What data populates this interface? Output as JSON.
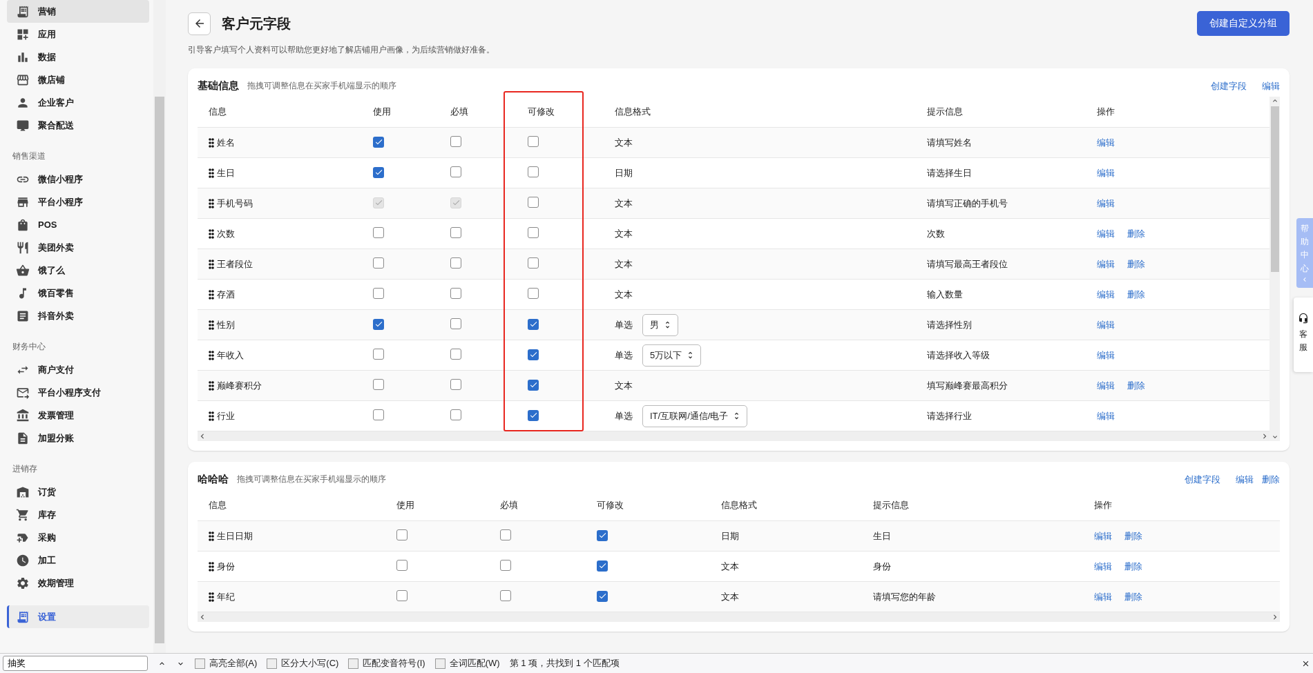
{
  "sidebar": {
    "groups": [
      {
        "items": [
          {
            "label": "营销",
            "selected": false,
            "hovered": true
          },
          {
            "label": "应用",
            "selected": false,
            "hovered": false
          },
          {
            "label": "数据",
            "selected": false,
            "hovered": false
          },
          {
            "label": "微店铺",
            "selected": false,
            "hovered": false
          },
          {
            "label": "企业客户",
            "selected": false,
            "hovered": false
          },
          {
            "label": "聚合配送",
            "selected": false,
            "hovered": false
          }
        ]
      },
      {
        "title": "销售渠道",
        "items": [
          {
            "label": "微信小程序",
            "selected": false,
            "hovered": false
          },
          {
            "label": "平台小程序",
            "selected": false,
            "hovered": false
          },
          {
            "label": "POS",
            "selected": false,
            "hovered": false
          },
          {
            "label": "美团外卖",
            "selected": false,
            "hovered": false
          },
          {
            "label": "饿了么",
            "selected": false,
            "hovered": false
          },
          {
            "label": "饿百零售",
            "selected": false,
            "hovered": false
          },
          {
            "label": "抖音外卖",
            "selected": false,
            "hovered": false
          }
        ]
      },
      {
        "title": "财务中心",
        "items": [
          {
            "label": "商户支付",
            "selected": false,
            "hovered": false
          },
          {
            "label": "平台小程序支付",
            "selected": false,
            "hovered": false
          },
          {
            "label": "发票管理",
            "selected": false,
            "hovered": false
          },
          {
            "label": "加盟分账",
            "selected": false,
            "hovered": false
          }
        ]
      },
      {
        "title": "进销存",
        "items": [
          {
            "label": "订货",
            "selected": false,
            "hovered": false
          },
          {
            "label": "库存",
            "selected": false,
            "hovered": false
          },
          {
            "label": "采购",
            "selected": false,
            "hovered": false
          },
          {
            "label": "加工",
            "selected": false,
            "hovered": false
          },
          {
            "label": "效期管理",
            "selected": false,
            "hovered": false
          }
        ]
      },
      {
        "items": [
          {
            "label": "设置",
            "selected": true,
            "hovered": false
          }
        ]
      }
    ]
  },
  "page": {
    "title": "客户元字段",
    "subtitle": "引导客户填写个人资料可以帮助您更好地了解店铺用户画像，为后续营销做好准备。",
    "primary_button": "创建自定义分组"
  },
  "sections": [
    {
      "title": "基础信息",
      "hint": "拖拽可调整信息在买家手机端显示的顺序",
      "actions": [
        "创建字段",
        "编辑"
      ],
      "columns": [
        {
          "label": "信息",
          "highlighted": false
        },
        {
          "label": "使用",
          "highlighted": false
        },
        {
          "label": "必填",
          "highlighted": false
        },
        {
          "label": "可修改",
          "highlighted": true
        },
        {
          "label": "信息格式",
          "highlighted": false
        },
        {
          "label": "提示信息",
          "highlighted": false
        },
        {
          "label": "操作",
          "highlighted": false
        }
      ],
      "rows": [
        {
          "name": "姓名",
          "use": {
            "checked": true,
            "disabled": false
          },
          "required": {
            "checked": false,
            "disabled": false
          },
          "editable": {
            "checked": false,
            "disabled": false
          },
          "format": "文本",
          "hint": "请填写姓名",
          "actions": [
            "编辑"
          ]
        },
        {
          "name": "生日",
          "use": {
            "checked": true,
            "disabled": false
          },
          "required": {
            "checked": false,
            "disabled": false
          },
          "editable": {
            "checked": false,
            "disabled": false
          },
          "format": "日期",
          "hint": "请选择生日",
          "actions": [
            "编辑"
          ]
        },
        {
          "name": "手机号码",
          "use": {
            "checked": true,
            "disabled": true
          },
          "required": {
            "checked": true,
            "disabled": true
          },
          "editable": {
            "checked": false,
            "disabled": false
          },
          "format": "文本",
          "hint": "请填写正确的手机号",
          "actions": [
            "编辑"
          ]
        },
        {
          "name": "次数",
          "use": {
            "checked": false,
            "disabled": false
          },
          "required": {
            "checked": false,
            "disabled": false
          },
          "editable": {
            "checked": false,
            "disabled": false
          },
          "format": "文本",
          "hint": "次数",
          "actions": [
            "编辑",
            "删除"
          ]
        },
        {
          "name": "王者段位",
          "use": {
            "checked": false,
            "disabled": false
          },
          "required": {
            "checked": false,
            "disabled": false
          },
          "editable": {
            "checked": false,
            "disabled": false
          },
          "format": "文本",
          "hint": "请填写最高王者段位",
          "actions": [
            "编辑",
            "删除"
          ]
        },
        {
          "name": "存酒",
          "use": {
            "checked": false,
            "disabled": false
          },
          "required": {
            "checked": false,
            "disabled": false
          },
          "editable": {
            "checked": false,
            "disabled": false
          },
          "format": "文本",
          "hint": "输入数量",
          "actions": [
            "编辑",
            "删除"
          ]
        },
        {
          "name": "性别",
          "use": {
            "checked": true,
            "disabled": false
          },
          "required": {
            "checked": false,
            "disabled": false
          },
          "editable": {
            "checked": true,
            "disabled": false
          },
          "format": "单选",
          "select": "男",
          "hint": "请选择性别",
          "actions": [
            "编辑"
          ]
        },
        {
          "name": "年收入",
          "use": {
            "checked": false,
            "disabled": false
          },
          "required": {
            "checked": false,
            "disabled": false
          },
          "editable": {
            "checked": true,
            "disabled": false
          },
          "format": "单选",
          "select": "5万以下",
          "hint": "请选择收入等级",
          "actions": [
            "编辑"
          ]
        },
        {
          "name": "巅峰赛积分",
          "use": {
            "checked": false,
            "disabled": false
          },
          "required": {
            "checked": false,
            "disabled": false
          },
          "editable": {
            "checked": true,
            "disabled": false
          },
          "format": "文本",
          "hint": "填写巅峰赛最高积分",
          "actions": [
            "编辑",
            "删除"
          ]
        },
        {
          "name": "行业",
          "use": {
            "checked": false,
            "disabled": false
          },
          "required": {
            "checked": false,
            "disabled": false
          },
          "editable": {
            "checked": true,
            "disabled": false
          },
          "format": "单选",
          "select": "IT/互联网/通信/电子",
          "hint": "请选择行业",
          "actions": [
            "编辑"
          ]
        }
      ]
    },
    {
      "title": "哈哈哈",
      "hint": "拖拽可调整信息在买家手机端显示的顺序",
      "actions": [
        "创建字段",
        "编辑",
        "删除"
      ],
      "columns": [
        {
          "label": "信息",
          "highlighted": false
        },
        {
          "label": "使用",
          "highlighted": false
        },
        {
          "label": "必填",
          "highlighted": false
        },
        {
          "label": "可修改",
          "highlighted": false
        },
        {
          "label": "信息格式",
          "highlighted": false
        },
        {
          "label": "提示信息",
          "highlighted": false
        },
        {
          "label": "操作",
          "highlighted": false
        }
      ],
      "rows": [
        {
          "name": "生日日期",
          "use": {
            "checked": false,
            "disabled": false
          },
          "required": {
            "checked": false,
            "disabled": false
          },
          "editable": {
            "checked": true,
            "disabled": false
          },
          "format": "日期",
          "hint": "生日",
          "actions": [
            "编辑",
            "删除"
          ]
        },
        {
          "name": "身份",
          "use": {
            "checked": false,
            "disabled": false
          },
          "required": {
            "checked": false,
            "disabled": false
          },
          "editable": {
            "checked": true,
            "disabled": false
          },
          "format": "文本",
          "hint": "身份",
          "actions": [
            "编辑",
            "删除"
          ]
        },
        {
          "name": "年纪",
          "use": {
            "checked": false,
            "disabled": false
          },
          "required": {
            "checked": false,
            "disabled": false
          },
          "editable": {
            "checked": true,
            "disabled": false
          },
          "format": "文本",
          "hint": "请填写您的年龄",
          "actions": [
            "编辑",
            "删除"
          ]
        }
      ]
    }
  ],
  "help_tab": {
    "label": "帮助中心"
  },
  "service_tab": {
    "label": "客服"
  },
  "find_bar": {
    "query": "抽奖",
    "options": [
      {
        "label": "高亮全部(A)",
        "checked": false
      },
      {
        "label": "区分大小写(C)",
        "checked": false
      },
      {
        "label": "匹配变音符号(I)",
        "checked": false
      },
      {
        "label": "全词匹配(W)",
        "checked": false
      }
    ],
    "status": "第 1 项，共找到 1 个匹配项"
  }
}
